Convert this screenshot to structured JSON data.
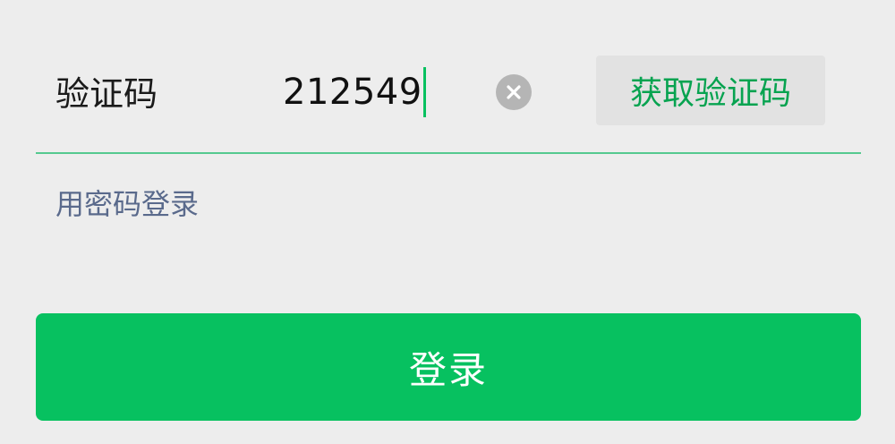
{
  "form": {
    "code_label": "验证码",
    "code_value": "212549",
    "get_code_label": "获取验证码",
    "password_login_label": "用密码登录",
    "login_button_label": "登录"
  },
  "icons": {
    "clear": "clear-circle-icon"
  },
  "colors": {
    "accent": "#07c160",
    "link": "#5a6a8c",
    "background": "#ededed"
  }
}
